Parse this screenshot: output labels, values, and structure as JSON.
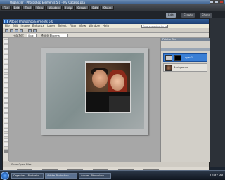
{
  "organizer": {
    "title": "Organizer - Photoshop Elements 5.0 - My Catalog.psa",
    "toolbar": [
      "File",
      "Edit",
      "Find",
      "View",
      "Window",
      "Help",
      "Create",
      "Edit",
      "Share"
    ],
    "tabs": [
      "Edit",
      "Create",
      "Share"
    ]
  },
  "editor": {
    "title": "Adobe Photoshop Elements 5.0",
    "menu": [
      "File",
      "Edit",
      "Image",
      "Enhance",
      "Layer",
      "Select",
      "Filter",
      "View",
      "Window",
      "Help"
    ],
    "help_placeholder": "Type a question for help",
    "options": {
      "feather_label": "Feather:",
      "feather_value": "0 px",
      "mode_label": "Mode:",
      "mode_value": "Normal"
    },
    "palette_bin": "Palette Bin",
    "layers": [
      "Layer 1",
      "Background"
    ],
    "photo_bin_label": "Show Open Files",
    "bin_items": 6
  },
  "taskbar": {
    "items": [
      "Organizer - Photosho...",
      "Adobe Photoshop...",
      "Adobe - Photoshop..."
    ],
    "clock": "10:42 PM"
  },
  "colors": {
    "accent": "#3a7fd5",
    "title_blue": "#1e3f71"
  }
}
